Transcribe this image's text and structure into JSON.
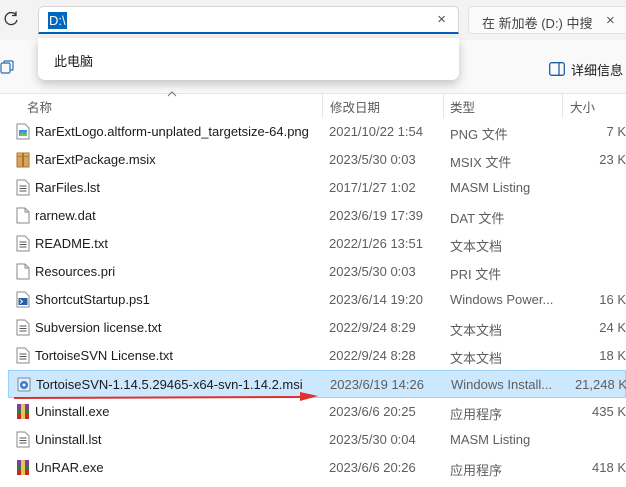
{
  "address": {
    "value": "D:\\",
    "clear_icon": "×"
  },
  "search": {
    "placeholder": "在 新加卷 (D:) 中搜",
    "clear_icon": "×"
  },
  "suggestion": {
    "item": "此电脑"
  },
  "toolbar": {
    "details_label": "详细信息"
  },
  "columns": {
    "name": "名称",
    "date": "修改日期",
    "type": "类型",
    "size": "大小"
  },
  "files": [
    {
      "name": "RarExtLogo.altform-unplated_targetsize-64.png",
      "date": "2021/10/22 1:54",
      "type": "PNG 文件",
      "size": "7 K",
      "icon": "image-file-icon"
    },
    {
      "name": "RarExtPackage.msix",
      "date": "2023/5/30 0:03",
      "type": "MSIX 文件",
      "size": "23 K",
      "icon": "package-file-icon"
    },
    {
      "name": "RarFiles.lst",
      "date": "2017/1/27 1:02",
      "type": "MASM Listing",
      "size": "",
      "icon": "text-file-icon"
    },
    {
      "name": "rarnew.dat",
      "date": "2023/6/19 17:39",
      "type": "DAT 文件",
      "size": "",
      "icon": "blank-file-icon"
    },
    {
      "name": "README.txt",
      "date": "2022/1/26 13:51",
      "type": "文本文档",
      "size": "",
      "icon": "text-file-icon"
    },
    {
      "name": "Resources.pri",
      "date": "2023/5/30 0:03",
      "type": "PRI 文件",
      "size": "",
      "icon": "blank-file-icon"
    },
    {
      "name": "ShortcutStartup.ps1",
      "date": "2023/6/14 19:20",
      "type": "Windows Power...",
      "size": "16 K",
      "icon": "powershell-file-icon"
    },
    {
      "name": "Subversion license.txt",
      "date": "2022/9/24 8:29",
      "type": "文本文档",
      "size": "24 K",
      "icon": "text-file-icon"
    },
    {
      "name": "TortoiseSVN License.txt",
      "date": "2022/9/24 8:28",
      "type": "文本文档",
      "size": "18 K",
      "icon": "text-file-icon"
    },
    {
      "name": "TortoiseSVN-1.14.5.29465-x64-svn-1.14.2.msi",
      "date": "2023/6/19 14:26",
      "type": "Windows Install...",
      "size": "21,248 K",
      "icon": "installer-file-icon",
      "selected": true
    },
    {
      "name": "Uninstall.exe",
      "date": "2023/6/6 20:25",
      "type": "应用程序",
      "size": "435 K",
      "icon": "winrar-exe-icon"
    },
    {
      "name": "Uninstall.lst",
      "date": "2023/5/30 0:04",
      "type": "MASM Listing",
      "size": "",
      "icon": "text-file-icon"
    },
    {
      "name": "UnRAR.exe",
      "date": "2023/6/6 20:26",
      "type": "应用程序",
      "size": "418 K",
      "icon": "winrar-exe-icon"
    }
  ],
  "colors": {
    "selection": "#cce8ff",
    "accent": "#005fb8",
    "annotation_arrow": "#e0302a"
  }
}
